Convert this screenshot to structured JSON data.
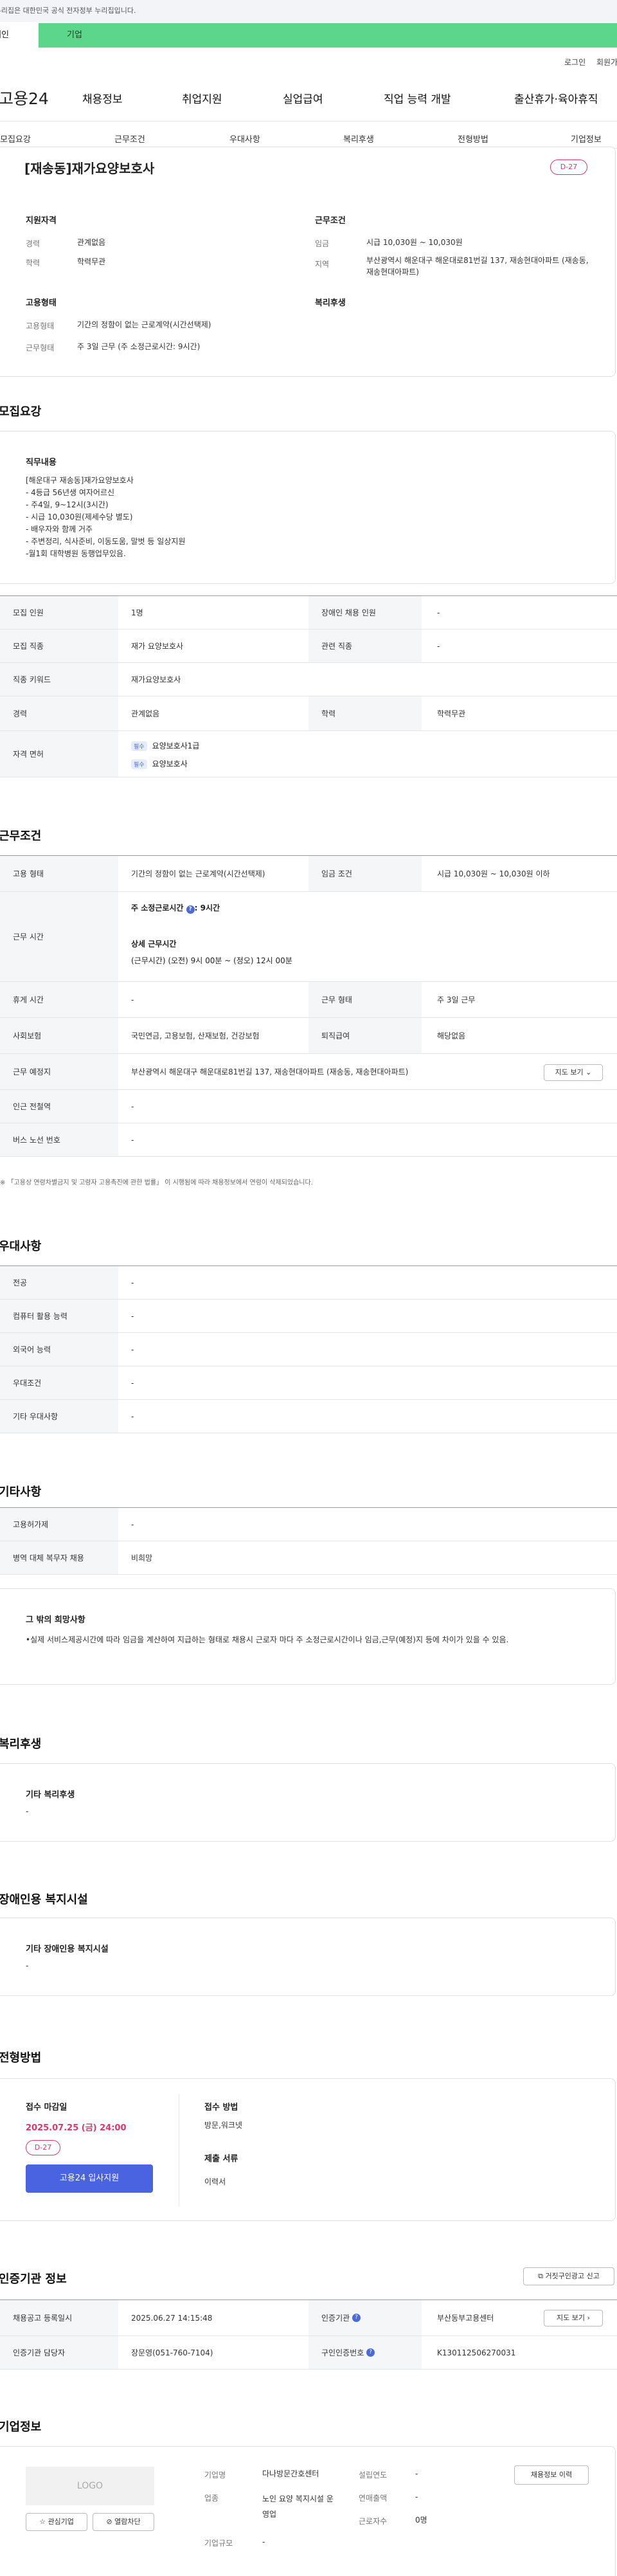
{
  "banner": {
    "text": "이 누리집은 대한민국 공식 전자정부 누리집입니다."
  },
  "service_tabs": {
    "personal": "개인",
    "company": "기업"
  },
  "util": {
    "login": "로그인",
    "join": "회원가입"
  },
  "logo": "고용24",
  "gnb": [
    "채용정보",
    "취업지원",
    "실업급여",
    "직업 능력 개발",
    "출산휴가·육아휴직"
  ],
  "subnav": [
    "모집요강",
    "근무조건",
    "우대사항",
    "복리후생",
    "전형방법",
    "기업정보"
  ],
  "job": {
    "title": "[재송동]재가요양보호사",
    "dday": "D-27",
    "qual_heading": "지원자격",
    "career_label": "경력",
    "career": "관계없음",
    "edu_label": "학력",
    "edu": "학력무관",
    "cond_heading": "근무조건",
    "wage_label": "임금",
    "wage": "시급 10,030원 ~ 10,030원",
    "region_label": "지역",
    "region": "부산광역시 해운대구 해운대로81번길 137, 재송현대아파트 (재송동, 재송현대아파트)",
    "emp_heading": "고용형태",
    "emp_type_label": "고용형태",
    "emp_type": "기간의 정함이 없는 근로계약(시간선택제)",
    "work_type_label": "근무형태",
    "work_type": "주 3일 근무 (주 소정근로시간: 9시간)",
    "welfare_heading": "복리후생"
  },
  "recruit": {
    "heading": "모집요강",
    "duty_heading": "직무내용",
    "duty": "[해운대구 재송동]재가요양보호사\n- 4등급 56년생 여자어르신\n- 주4일, 9~12시(3시간)\n- 시급 10,030원(제세수당 별도)\n- 배우자와 함께 거주\n- 주변정리, 식사준비, 이동도움, 말벗 등 일상지원\n-월1회 대학병원 동행업무있음.",
    "people_label": "모집 인원",
    "people": "1명",
    "disabled_label": "장애인 채용 인원",
    "disabled": "-",
    "job_label": "모집 직종",
    "job": "재가 요양보호사",
    "related_label": "관련 직종",
    "related": "-",
    "keyword_label": "직종 키워드",
    "keyword": "재가요양보호사",
    "career_label": "경력",
    "career": "관계없음",
    "edu_label": "학력",
    "edu": "학력무관",
    "license_label": "자격 면허",
    "license_badge": "필수",
    "license1": "요양보호사1급",
    "license2": "요양보호사"
  },
  "conditions": {
    "heading": "근무조건",
    "emp_label": "고용 형태",
    "emp": "기간의 정함이 없는 근로계약(시간선택제)",
    "wage_label": "임금 조건",
    "wage": "시급 10,030원 ~ 10,030원 이하",
    "hours_label": "근무 시간",
    "hours_weekly": "주 소정근로시간",
    "hours_weekly_val": ": 9시간",
    "hours_detail_heading": "상세 근무시간",
    "hours_detail": "(근무시간) (오전) 9시 00분 ~ (정오) 12시 00분",
    "rest_label": "휴게 시간",
    "rest": "-",
    "form_label": "근무 형태",
    "form": "주 3일 근무",
    "insurance_label": "사회보험",
    "insurance": "국민연금, 고용보험, 산재보험, 건강보험",
    "severance_label": "퇴직급여",
    "severance": "해당없음",
    "place_label": "근무 예정지",
    "place": "부산광역시 해운대구 해운대로81번길 137, 재송현대아파트 (재송동, 재송현대아파트)",
    "map_button": "지도 보기",
    "subway_label": "인근 전철역",
    "subway": "-",
    "bus_label": "버스 노선 번호",
    "bus": "-",
    "note": "「고용상 연령차별금지 및 고령자 고용촉진에 관한 법률」 이 시행됨에 따라 채용정보에서 연령이 삭제되었습니다."
  },
  "preference": {
    "heading": "우대사항",
    "rows": [
      {
        "label": "전공",
        "value": "-"
      },
      {
        "label": "컴퓨터 활용 능력",
        "value": "-"
      },
      {
        "label": "외국어 능력",
        "value": "-"
      },
      {
        "label": "우대조건",
        "value": "-"
      },
      {
        "label": "기타 우대사항",
        "value": "-"
      }
    ]
  },
  "etc": {
    "heading": "기타사항",
    "rows": [
      {
        "label": "고용허가제",
        "value": "-"
      },
      {
        "label": "병역 대체 복무자 채용",
        "value": "비희망"
      }
    ],
    "other_heading": "그 밖의 희망사항",
    "other": "•실제 서비스제공시간에 따라 임금을 계산하여 지급하는 형태로 채용시 근로자 마다 주 소정근로시간이나 임금,근무(예정)지 등에 차이가 있을 수 있음."
  },
  "welfare": {
    "heading": "복리후생",
    "sub": "기타 복리후생",
    "value": "-"
  },
  "disabled_fac": {
    "heading": "장애인용 복지시설",
    "sub": "기타 장애인용 복지시설",
    "value": "-"
  },
  "screening": {
    "heading": "전형방법",
    "deadline_heading": "접수 마감일",
    "deadline": "2025.07.25 (금) 24:00",
    "dday": "D-27",
    "apply_button": "고용24 입사지원",
    "method_heading": "접수 방법",
    "method": "방문,워크넷",
    "docs_heading": "제출 서류",
    "docs": "이력서"
  },
  "cert": {
    "heading": "인증기관 정보",
    "report_button": "거짓구인광고 신고",
    "reg_label": "채용공고 등록일시",
    "reg": "2025.06.27 14:15:48",
    "agency_label": "인증기관",
    "agency": "부산동부고용센터",
    "map_button": "지도 보기",
    "manager_label": "인증기관 담당자",
    "manager": "장문영(051-760-7104)",
    "no_label": "구인인증번호",
    "no": "K130112506270031"
  },
  "company": {
    "heading": "기업정보",
    "logo_placeholder": "LOGO",
    "fav_button": "관심기업",
    "block_button": "열람차단",
    "name_label": "기업명",
    "name": "다나방문간호센터",
    "industry_label": "업종",
    "industry": "노인 요양 복지시설 운영업",
    "size_label": "기업규모",
    "size": "-",
    "year_label": "설립연도",
    "year": "-",
    "sales_label": "연매출액",
    "sales": "-",
    "staff_label": "근로자수",
    "staff": "0명",
    "history_button": "채용정보 이력"
  },
  "colors": {
    "accent_green": "#5cd68a",
    "dday_pink": "#e0356b",
    "apply_blue": "#4a63e0"
  }
}
